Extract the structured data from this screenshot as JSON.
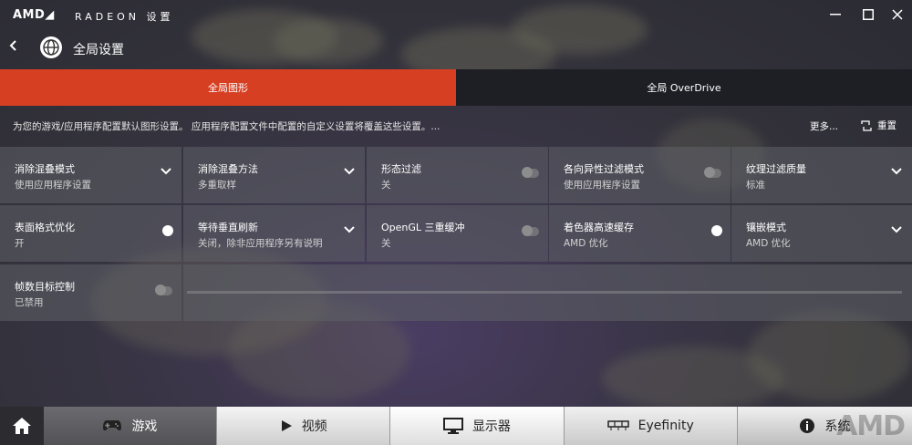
{
  "titlebar": {
    "logo": "AMD◢",
    "brand": "RADEON 设置",
    "minimize_icon": "—",
    "close_icon": "✕"
  },
  "header": {
    "back_icon": "‹",
    "title": "全局设置"
  },
  "tabs": [
    {
      "label": "全局图形",
      "active": true
    },
    {
      "label": "全局 OverDrive",
      "active": false
    }
  ],
  "description": "为您的游戏/应用程序配置默认图形设置。 应用程序配置文件中配置的自定义设置将覆盖这些设置。...",
  "more_label": "更多...",
  "reset_label": "重置",
  "settings": [
    {
      "title": "消除混叠模式",
      "value": "使用应用程序设置",
      "control": "dropdown"
    },
    {
      "title": "消除混叠方法",
      "value": "多重取样",
      "control": "dropdown"
    },
    {
      "title": "形态过滤",
      "value": "关",
      "control": "toggle",
      "on": false
    },
    {
      "title": "各向异性过滤模式",
      "value": "使用应用程序设置",
      "control": "toggle",
      "on": false
    },
    {
      "title": "纹理过滤质量",
      "value": "标准",
      "control": "dropdown"
    },
    {
      "title": "表面格式优化",
      "value": "开",
      "control": "toggle",
      "on": true
    },
    {
      "title": "等待垂直刷新",
      "value": "关闭，除非应用程序另有说明",
      "control": "dropdown"
    },
    {
      "title": "OpenGL 三重缓冲",
      "value": "关",
      "control": "toggle",
      "on": false
    },
    {
      "title": "着色器高速缓存",
      "value": "AMD 优化",
      "control": "toggle",
      "on": true
    },
    {
      "title": "镶嵌模式",
      "value": "AMD 优化",
      "control": "dropdown"
    },
    {
      "title": "帧数目标控制",
      "value": "已禁用",
      "control": "toggle",
      "on": false
    }
  ],
  "taskbar": {
    "games": "游戏",
    "video": "视频",
    "display": "显示器",
    "eyefinity": "Eyefinity",
    "system": "系统",
    "amd_watermark": "AMD"
  },
  "colors": {
    "accent": "#d73f22",
    "inactive_tab": "#1e1f25"
  }
}
